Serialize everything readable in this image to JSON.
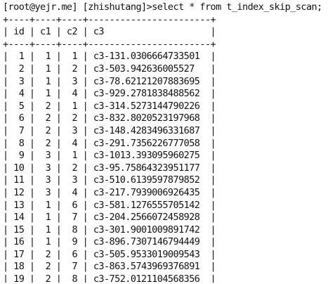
{
  "terminal": {
    "prompt": "[root@yejr.me] [zhishutang]>",
    "command": "select * from t_index_skip_scan;",
    "separator": "+----+----+----+-----------------------+",
    "header": "| id | c1 | c2 | c3                    |",
    "rows": [
      "|  1 |  1 |  1 | c3-131.0306664733501  |",
      "|  2 |  1 |  2 | c3-503.942636005527   |",
      "|  3 |  1 |  3 | c3-78.62121207883695  |",
      "|  4 |  1 |  4 | c3-929.2781838488562  |",
      "|  5 |  2 |  1 | c3-314.5273144790226  |",
      "|  6 |  2 |  2 | c3-832.8020523197968  |",
      "|  7 |  2 |  3 | c3-148.4283496331687  |",
      "|  8 |  2 |  4 | c3-291.7356226777058  |",
      "|  9 |  3 |  1 | c3-1013.393095960275  |",
      "| 10 |  3 |  2 | c3-95.75864323951177  |",
      "| 11 |  3 |  3 | c3-510.6139597879852  |",
      "| 12 |  3 |  4 | c3-217.7939006926435  |",
      "| 13 |  1 |  6 | c3-581.1276555705142  |",
      "| 14 |  1 |  7 | c3-204.2566072458928  |",
      "| 15 |  1 |  8 | c3-301.9001009891742  |",
      "| 16 |  1 |  9 | c3-896.7307146794449  |",
      "| 17 |  2 |  6 | c3-505.9533019009543  |",
      "| 18 |  2 |  7 | c3-863.5743969376891  |",
      "| 19 |  2 |  8 | c3-752.0121104568356  |"
    ]
  }
}
